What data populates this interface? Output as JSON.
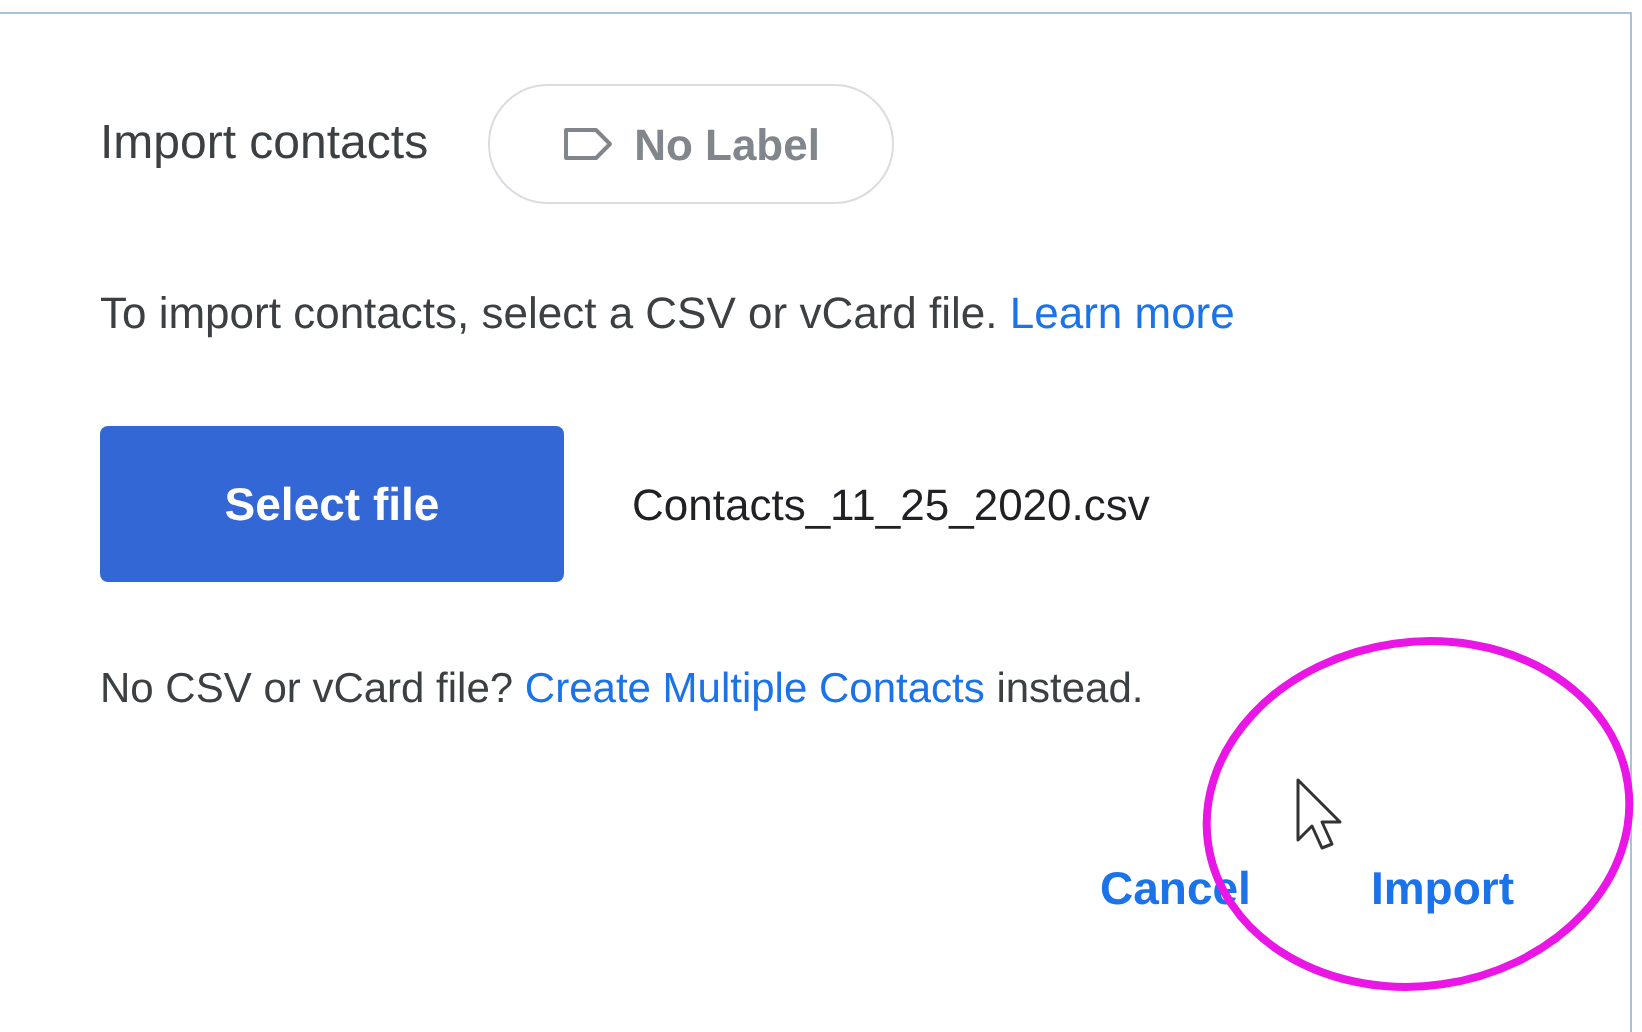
{
  "title": "Import contacts",
  "label_chip": {
    "text": "No Label"
  },
  "instructions": {
    "text": "To import contacts, select a CSV or vCard file.",
    "link": "Learn more"
  },
  "select_button": "Select file",
  "file_name": "Contacts_11_25_2020.csv",
  "alternative": {
    "prefix": "No CSV or vCard file?",
    "link": "Create Multiple Contacts",
    "suffix": "instead."
  },
  "buttons": [
    "Cancel",
    "Import"
  ]
}
